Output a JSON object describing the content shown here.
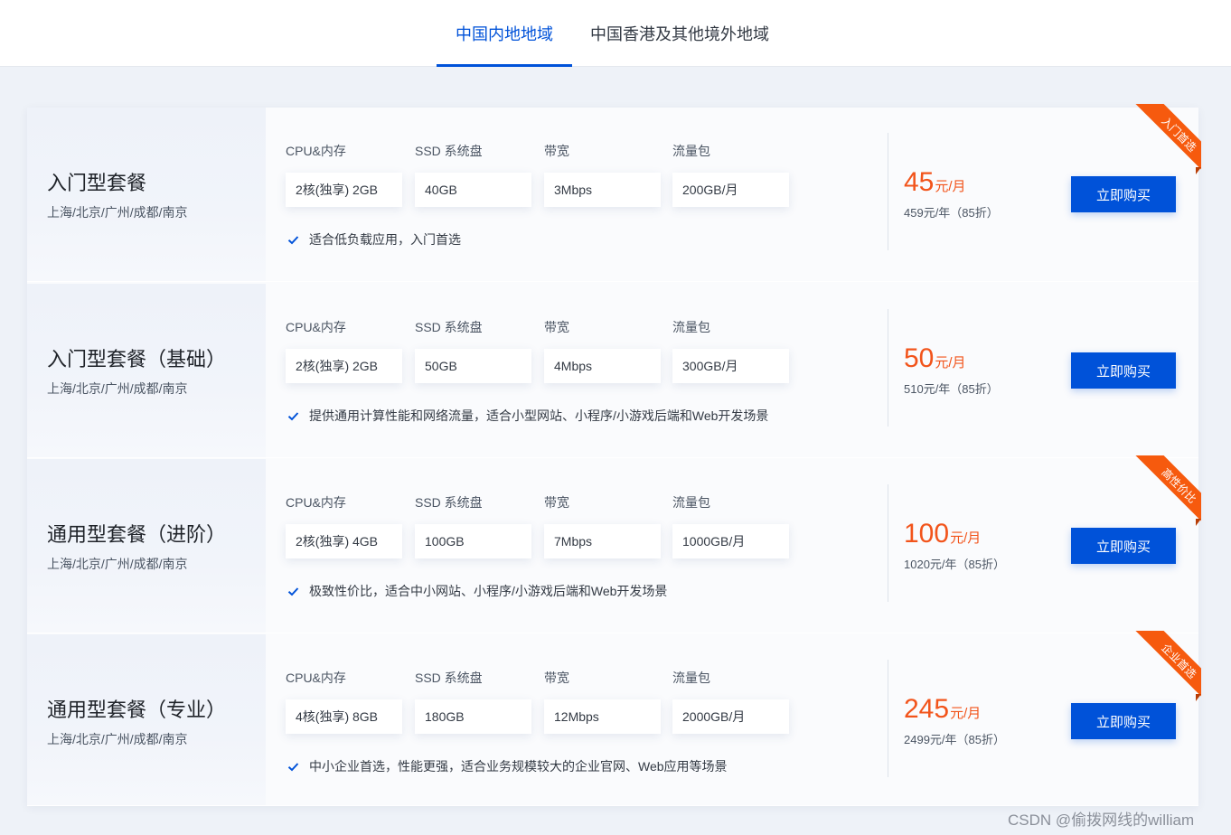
{
  "tabs": [
    {
      "label": "中国内地地域",
      "active": true
    },
    {
      "label": "中国香港及其他境外地域",
      "active": false
    }
  ],
  "spec_labels": [
    "CPU&内存",
    "SSD 系统盘",
    "带宽",
    "流量包"
  ],
  "colors": {
    "accent": "#0052d9",
    "price": "#f2541b",
    "ribbon": "#f65a0e"
  },
  "plans": [
    {
      "name": "入门型套餐",
      "regions": "上海/北京/广州/成都/南京",
      "specs": [
        "2核(独享) 2GB",
        "40GB",
        "3Mbps",
        "200GB/月"
      ],
      "feature": "适合低负载应用，入门首选",
      "price": "45",
      "price_unit": "元/月",
      "yearly": "459元/年（85折）",
      "button": "立即购买",
      "ribbon": "入门首选"
    },
    {
      "name": "入门型套餐（基础）",
      "regions": "上海/北京/广州/成都/南京",
      "specs": [
        "2核(独享) 2GB",
        "50GB",
        "4Mbps",
        "300GB/月"
      ],
      "feature": "提供通用计算性能和网络流量，适合小型网站、小程序/小游戏后端和Web开发场景",
      "price": "50",
      "price_unit": "元/月",
      "yearly": "510元/年（85折）",
      "button": "立即购买",
      "ribbon": ""
    },
    {
      "name": "通用型套餐（进阶）",
      "regions": "上海/北京/广州/成都/南京",
      "specs": [
        "2核(独享) 4GB",
        "100GB",
        "7Mbps",
        "1000GB/月"
      ],
      "feature": "极致性价比，适合中小网站、小程序/小游戏后端和Web开发场景",
      "price": "100",
      "price_unit": "元/月",
      "yearly": "1020元/年（85折）",
      "button": "立即购买",
      "ribbon": "高性价比"
    },
    {
      "name": "通用型套餐（专业）",
      "regions": "上海/北京/广州/成都/南京",
      "specs": [
        "4核(独享) 8GB",
        "180GB",
        "12Mbps",
        "2000GB/月"
      ],
      "feature": "中小企业首选，性能更强，适合业务规模较大的企业官网、Web应用等场景",
      "price": "245",
      "price_unit": "元/月",
      "yearly": "2499元/年（85折）",
      "button": "立即购买",
      "ribbon": "企业首选"
    }
  ],
  "watermark": "CSDN @偷拨网线的william"
}
